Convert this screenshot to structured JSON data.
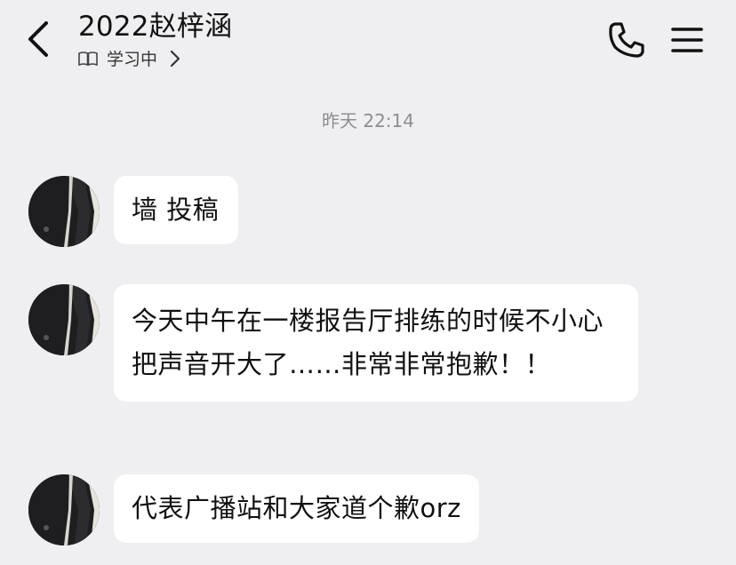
{
  "header": {
    "title": "2022赵梓涵",
    "status": "学习中",
    "back_icon": "back-chevron-icon",
    "phone_icon": "phone-icon",
    "menu_icon": "hamburger-menu-icon"
  },
  "timestamp": "昨天 22:14",
  "messages": [
    {
      "text": "墙 投稿"
    },
    {
      "text": "今天中午在一楼报告厅排练的时候不小心把声音开大了……非常非常抱歉！！"
    },
    {
      "text": "代表广播站和大家道个歉orz"
    }
  ]
}
